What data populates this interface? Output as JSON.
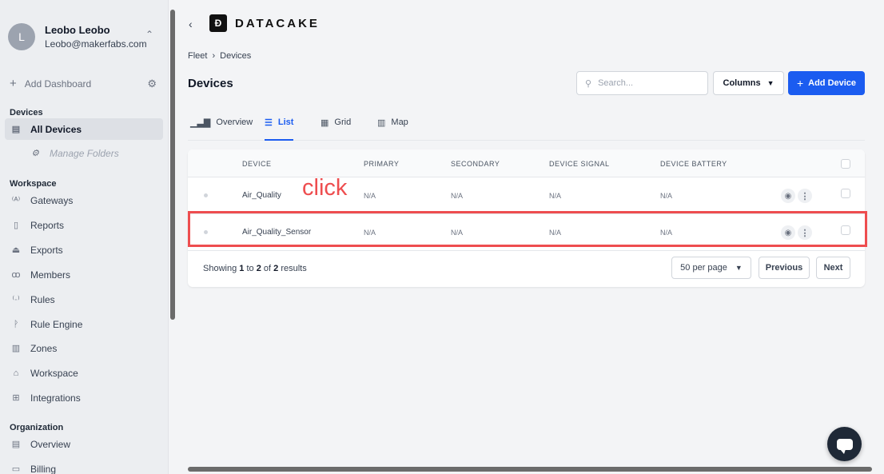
{
  "user": {
    "initial": "L",
    "name": "Leobo Leobo",
    "email": "Leobo@makerfabs.com"
  },
  "sidebar": {
    "add_dashboard": "Add Dashboard",
    "sections": {
      "devices": "Devices",
      "workspace": "Workspace",
      "organization": "Organization"
    },
    "items": [
      {
        "label": "All Devices",
        "icon": "devices-icon"
      },
      {
        "label": "Manage Folders",
        "icon": "gear-icon"
      },
      {
        "label": "Gateways",
        "icon": "gateway-icon"
      },
      {
        "label": "Reports",
        "icon": "report-icon"
      },
      {
        "label": "Exports",
        "icon": "export-icon"
      },
      {
        "label": "Members",
        "icon": "members-icon"
      },
      {
        "label": "Rules",
        "icon": "rules-icon"
      },
      {
        "label": "Rule Engine",
        "icon": "rule-engine-icon"
      },
      {
        "label": "Zones",
        "icon": "zones-icon"
      },
      {
        "label": "Workspace",
        "icon": "workspace-icon"
      },
      {
        "label": "Integrations",
        "icon": "integrations-icon"
      },
      {
        "label": "Overview",
        "icon": "overview-icon"
      },
      {
        "label": "Billing",
        "icon": "billing-icon"
      }
    ]
  },
  "header": {
    "logo_text": "DATACAKE",
    "breadcrumb": [
      "Fleet",
      "Devices"
    ],
    "title": "Devices"
  },
  "toolbar": {
    "search_placeholder": "Search...",
    "columns_label": "Columns",
    "add_device_label": "Add Device"
  },
  "tabs": [
    {
      "label": "Overview",
      "icon": "bar-chart-icon"
    },
    {
      "label": "List",
      "icon": "list-icon",
      "active": true
    },
    {
      "label": "Grid",
      "icon": "grid-icon"
    },
    {
      "label": "Map",
      "icon": "map-icon"
    }
  ],
  "table": {
    "columns": [
      "DEVICE",
      "PRIMARY",
      "SECONDARY",
      "DEVICE SIGNAL",
      "DEVICE BATTERY"
    ],
    "rows": [
      {
        "device": "Air_Quality",
        "primary": "N/A",
        "secondary": "N/A",
        "signal": "N/A",
        "battery": "N/A"
      },
      {
        "device": "Air_Quality_Sensor",
        "primary": "N/A",
        "secondary": "N/A",
        "signal": "N/A",
        "battery": "N/A"
      }
    ]
  },
  "pagination": {
    "showing_prefix": "Showing",
    "from": "1",
    "to_word": "to",
    "to": "2",
    "of_word": "of",
    "total": "2",
    "results_word": "results",
    "per_page": "50 per page",
    "previous": "Previous",
    "next": "Next"
  },
  "annotation": {
    "label": "click",
    "color": "#ee4d4f"
  },
  "colors": {
    "accent": "#1b5cf0",
    "sidebar_bg": "#eceef1"
  }
}
